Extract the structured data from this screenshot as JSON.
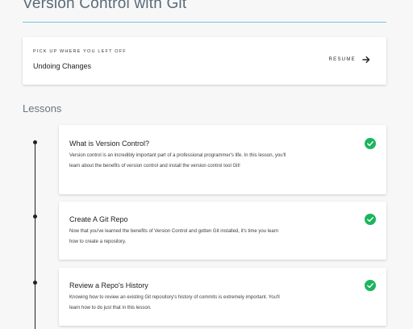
{
  "header": {
    "title": "Version Control with Git"
  },
  "resume": {
    "kicker": "PICK UP WHERE YOU LEFT OFF",
    "lesson": "Undoing Changes",
    "button_label": "RESUME",
    "icon": "arrow-right-icon"
  },
  "lessons_section": {
    "title": "Lessons",
    "items": [
      {
        "title": "What is Version Control?",
        "description": "Version control is an incredibly important part of a professional programmer's life. In this lesson, you'll learn about the benefits of version control and install the version control tool Git!",
        "status_icon": "check-circle-icon",
        "completed": true
      },
      {
        "title": "Create A Git Repo",
        "description": "Now that you've learned the benefits of Version Control and gotten Git installed, it's time you learn how to create a repository.",
        "status_icon": "check-circle-icon",
        "completed": true
      },
      {
        "title": "Review a Repo's History",
        "description": "Knowing how to review an existing Git repository's history of commits is extremely important. You'll learn how to do just that in this lesson.",
        "status_icon": "check-circle-icon",
        "completed": true
      }
    ]
  },
  "colors": {
    "accent_rule": "#77c7d6",
    "check_green": "#1cb55e",
    "timeline": "#222222"
  }
}
